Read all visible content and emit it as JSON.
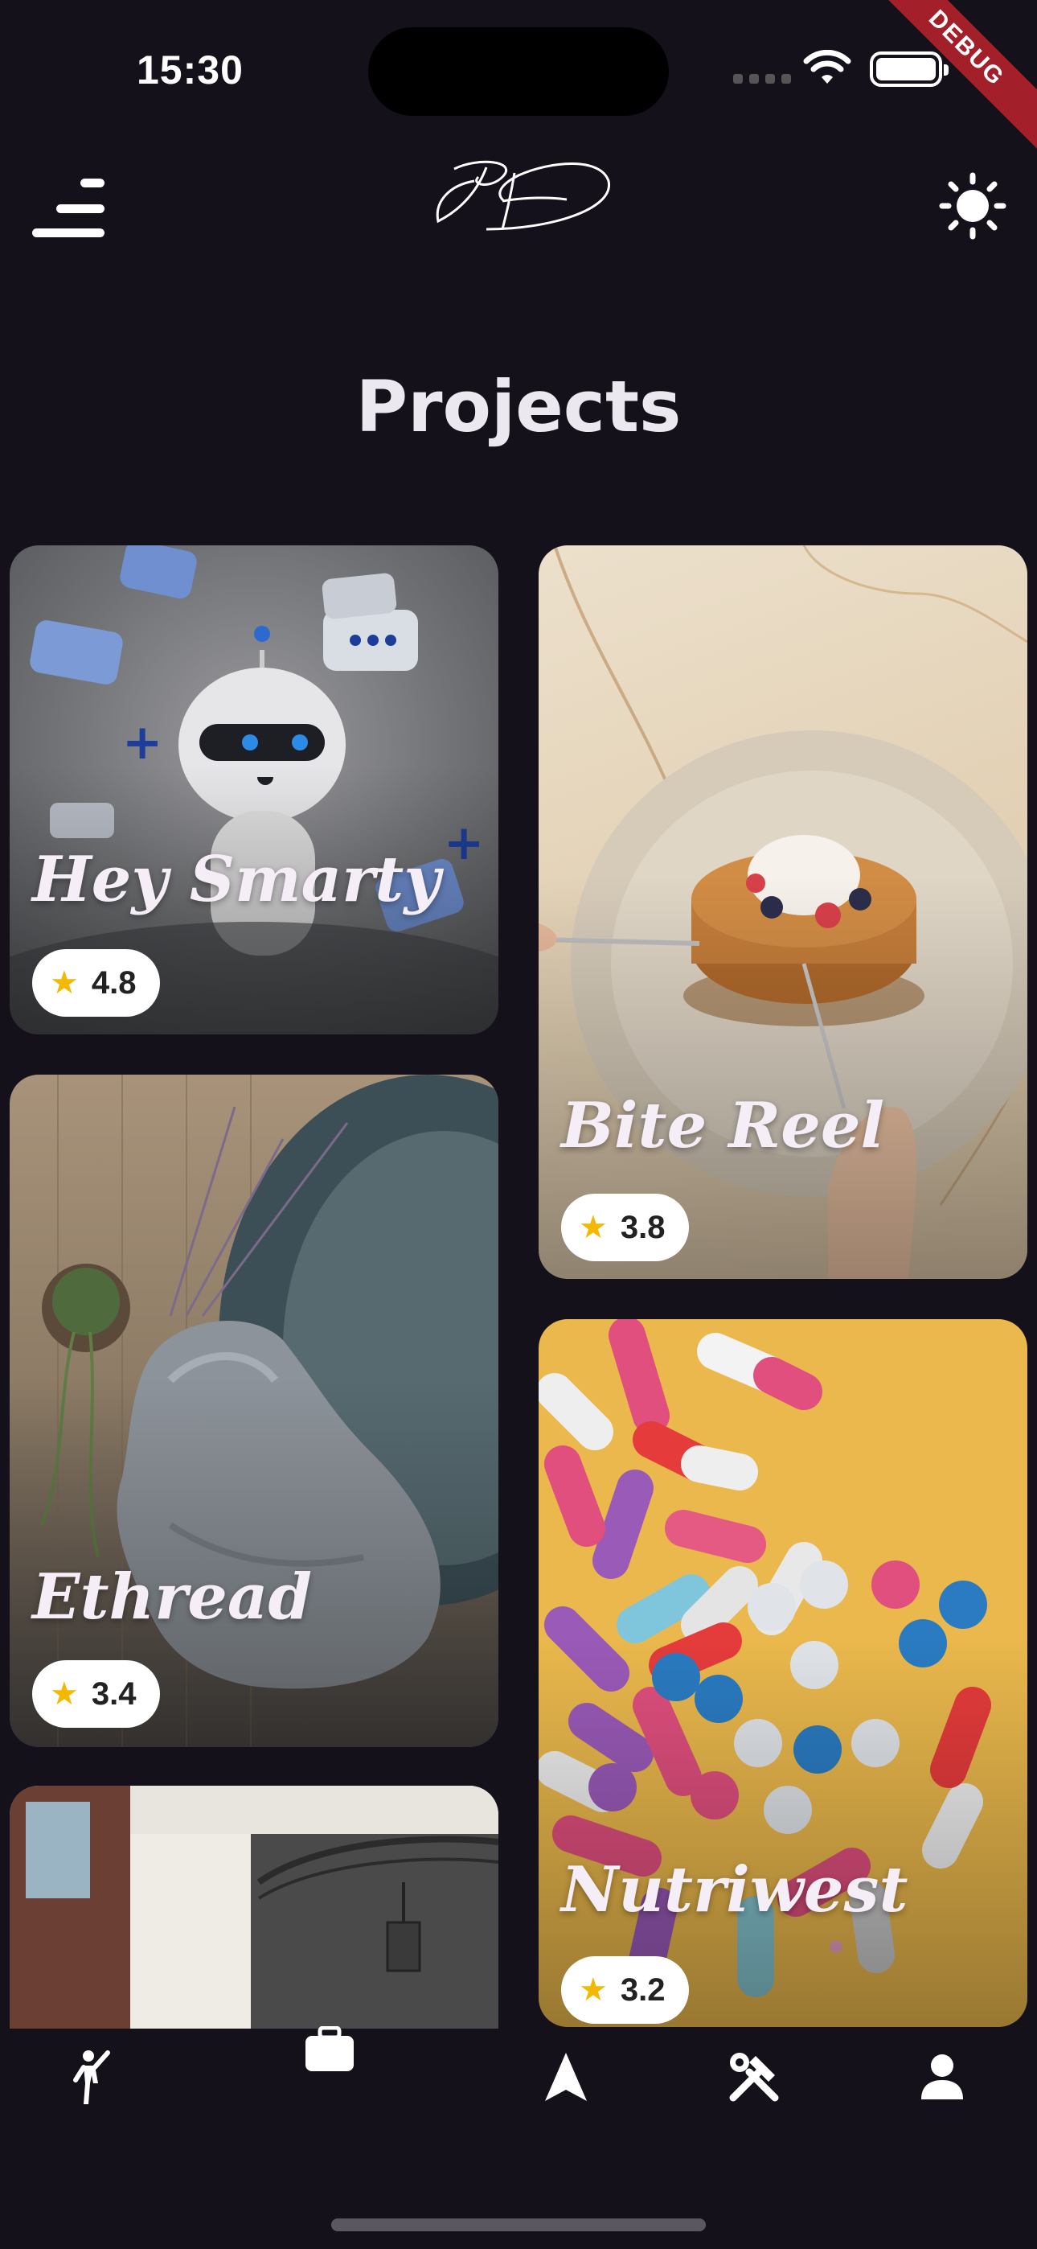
{
  "status_bar": {
    "time": "15:30",
    "debug_label": "DEBUG"
  },
  "header": {
    "menu_icon": "menu-icon",
    "logo_alt": "signature-logo",
    "theme_icon": "sun-icon"
  },
  "page": {
    "title": "Projects"
  },
  "projects": [
    {
      "title": "Hey Smarty",
      "rating": "4.8",
      "image": "robot-chat-illustration"
    },
    {
      "title": "Bite Reel",
      "rating": "3.8",
      "image": "pancakes-plate-photo"
    },
    {
      "title": "Ethread",
      "rating": "3.4",
      "image": "knitted-sweater-photo"
    },
    {
      "title": "Nutriwest",
      "rating": "3.2",
      "image": "pills-capsules-photo"
    },
    {
      "title": "",
      "rating": "",
      "image": "building-archway-photo"
    }
  ],
  "bottom_nav": [
    {
      "icon": "person-waving-icon",
      "selected": false
    },
    {
      "icon": "briefcase-icon",
      "selected": true
    },
    {
      "icon": "navigation-arrow-icon",
      "selected": false
    },
    {
      "icon": "tools-icon",
      "selected": false
    },
    {
      "icon": "profile-icon",
      "selected": false
    }
  ],
  "colors": {
    "background": "#14111a",
    "title": "#ece8f0",
    "rating_star": "#f5b800",
    "debug_ribbon": "#a3202a"
  }
}
